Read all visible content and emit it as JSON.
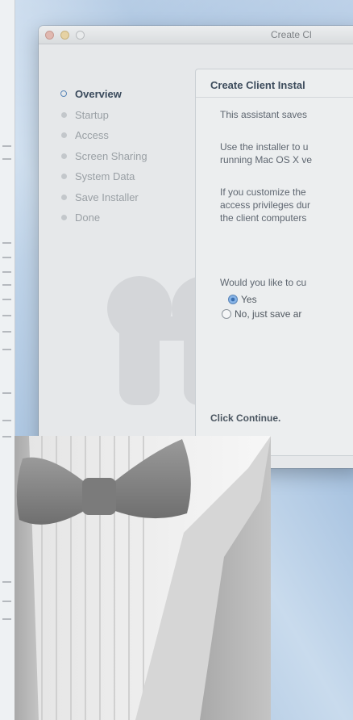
{
  "window": {
    "title": "Create Cl",
    "traffic_lights": [
      "close",
      "minimize",
      "zoom"
    ]
  },
  "sidebar": {
    "steps": [
      {
        "label": "Overview",
        "active": true
      },
      {
        "label": "Startup",
        "active": false
      },
      {
        "label": "Access",
        "active": false
      },
      {
        "label": "Screen Sharing",
        "active": false
      },
      {
        "label": "System Data",
        "active": false
      },
      {
        "label": "Save Installer",
        "active": false
      },
      {
        "label": "Done",
        "active": false
      }
    ]
  },
  "panel": {
    "title": "Create Client Instal",
    "para1": "This assistant saves",
    "para2_line1": "Use the installer to u",
    "para2_line2": "running Mac OS X ve",
    "para3_line1": "If you customize the",
    "para3_line2": "access privileges dur",
    "para3_line3": "the client computers",
    "question": "Would you like to cu",
    "option_yes": "Yes",
    "option_no": "No, just save ar",
    "selected": "yes",
    "cta": "Click Continue."
  },
  "colors": {
    "accent": "#5a86b8",
    "desktop": "#b9cfe4"
  },
  "icons": [
    "binoculars-watermark-icon",
    "tuxedo-bowtie-icon"
  ]
}
